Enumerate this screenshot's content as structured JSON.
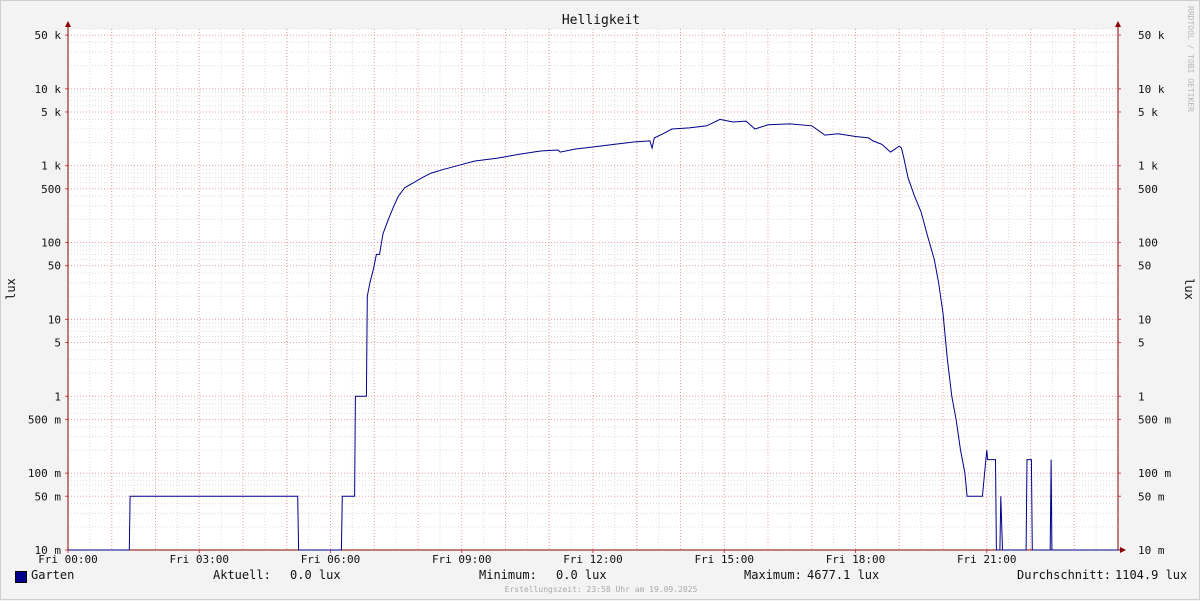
{
  "chart_data": {
    "type": "line",
    "title": "Helligkeit",
    "ylabel": "lux",
    "yscale": "log",
    "ylim": [
      0.01,
      60000
    ],
    "y_ticks": [
      {
        "value": 50000,
        "label": "50 k"
      },
      {
        "value": 10000,
        "label": "10 k"
      },
      {
        "value": 5000,
        "label": "5 k"
      },
      {
        "value": 1000,
        "label": "1 k"
      },
      {
        "value": 500,
        "label": "500"
      },
      {
        "value": 100,
        "label": "100"
      },
      {
        "value": 50,
        "label": "50"
      },
      {
        "value": 10,
        "label": "10"
      },
      {
        "value": 5,
        "label": "5"
      },
      {
        "value": 1,
        "label": "1"
      },
      {
        "value": 0.5,
        "label": "500 m"
      },
      {
        "value": 0.1,
        "label": "100 m"
      },
      {
        "value": 0.05,
        "label": "50 m"
      },
      {
        "value": 0.01,
        "label": "10 m"
      }
    ],
    "x_unit": "hour",
    "xlim": [
      0,
      24
    ],
    "x_ticks": [
      {
        "value": 0,
        "label": "Fri 00:00"
      },
      {
        "value": 3,
        "label": "Fri 03:00"
      },
      {
        "value": 6,
        "label": "Fri 06:00"
      },
      {
        "value": 9,
        "label": "Fri 09:00"
      },
      {
        "value": 12,
        "label": "Fri 12:00"
      },
      {
        "value": 15,
        "label": "Fri 15:00"
      },
      {
        "value": 18,
        "label": "Fri 18:00"
      },
      {
        "value": 21,
        "label": "Fri 21:00"
      }
    ],
    "grid": true,
    "series": [
      {
        "name": "Garten",
        "color": "#00008b",
        "points": [
          [
            0.0,
            0.01
          ],
          [
            1.4,
            0.01
          ],
          [
            1.42,
            0.05
          ],
          [
            5.25,
            0.05
          ],
          [
            5.27,
            0.01
          ],
          [
            6.25,
            0.01
          ],
          [
            6.27,
            0.05
          ],
          [
            6.55,
            0.05
          ],
          [
            6.57,
            1
          ],
          [
            6.82,
            1
          ],
          [
            6.84,
            20
          ],
          [
            6.9,
            30
          ],
          [
            6.98,
            45
          ],
          [
            7.05,
            70
          ],
          [
            7.12,
            70
          ],
          [
            7.2,
            130
          ],
          [
            7.32,
            200
          ],
          [
            7.45,
            300
          ],
          [
            7.55,
            400
          ],
          [
            7.7,
            520
          ],
          [
            7.9,
            600
          ],
          [
            8.1,
            700
          ],
          [
            8.3,
            800
          ],
          [
            8.6,
            900
          ],
          [
            8.9,
            1000
          ],
          [
            9.3,
            1150
          ],
          [
            9.8,
            1250
          ],
          [
            10.3,
            1400
          ],
          [
            10.8,
            1550
          ],
          [
            11.2,
            1600
          ],
          [
            11.25,
            1500
          ],
          [
            11.6,
            1650
          ],
          [
            12.0,
            1750
          ],
          [
            12.5,
            1900
          ],
          [
            13.0,
            2050
          ],
          [
            13.3,
            2100
          ],
          [
            13.35,
            1700
          ],
          [
            13.4,
            2300
          ],
          [
            13.6,
            2600
          ],
          [
            13.8,
            3000
          ],
          [
            14.2,
            3100
          ],
          [
            14.6,
            3300
          ],
          [
            14.9,
            4000
          ],
          [
            15.2,
            3700
          ],
          [
            15.5,
            3800
          ],
          [
            15.7,
            3000
          ],
          [
            16.0,
            3400
          ],
          [
            16.5,
            3500
          ],
          [
            17.0,
            3300
          ],
          [
            17.3,
            2500
          ],
          [
            17.6,
            2600
          ],
          [
            18.0,
            2400
          ],
          [
            18.3,
            2300
          ],
          [
            18.4,
            2100
          ],
          [
            18.6,
            1900
          ],
          [
            18.8,
            1500
          ],
          [
            19.0,
            1800
          ],
          [
            19.05,
            1700
          ],
          [
            19.1,
            1300
          ],
          [
            19.2,
            700
          ],
          [
            19.35,
            400
          ],
          [
            19.5,
            250
          ],
          [
            19.65,
            120
          ],
          [
            19.8,
            60
          ],
          [
            19.9,
            30
          ],
          [
            20.0,
            12
          ],
          [
            20.1,
            3
          ],
          [
            20.2,
            1
          ],
          [
            20.3,
            0.5
          ],
          [
            20.4,
            0.2
          ],
          [
            20.5,
            0.1
          ],
          [
            20.55,
            0.05
          ],
          [
            20.9,
            0.05
          ],
          [
            21.0,
            0.2
          ],
          [
            21.02,
            0.15
          ],
          [
            21.2,
            0.15
          ],
          [
            21.22,
            0.01
          ],
          [
            21.3,
            0.01
          ],
          [
            21.32,
            0.05
          ],
          [
            21.36,
            0.01
          ],
          [
            21.9,
            0.01
          ],
          [
            21.92,
            0.15
          ],
          [
            22.02,
            0.15
          ],
          [
            22.04,
            0.01
          ],
          [
            22.45,
            0.01
          ],
          [
            22.47,
            0.15
          ],
          [
            22.49,
            0.01
          ],
          [
            24.0,
            0.01
          ]
        ]
      }
    ],
    "stats": {
      "current": "0.0 lux",
      "minimum": "0.0 lux",
      "maximum": "4677.1 lux",
      "average": "1104.9 lux"
    }
  },
  "legend": {
    "series_name": "Garten",
    "current_label": "Aktuell:",
    "current_value": "0.0 lux",
    "minimum_label": "Minimum:",
    "minimum_value": "0.0 lux",
    "maximum_label": "Maximum:",
    "maximum_value": "4677.1 lux",
    "average_label": "Durchschnitt:",
    "average_value": "1104.9 lux"
  },
  "watermark": "RRDTOOL / TOBI OETIKER",
  "footer": "Erstellungszeit: 23:58 Uhr am 19.09.2025"
}
